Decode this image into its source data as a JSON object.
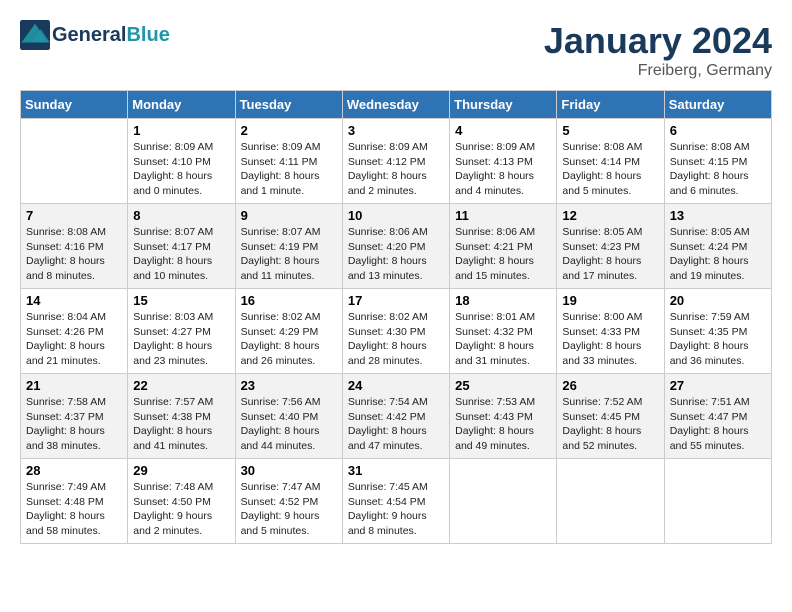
{
  "header": {
    "logo_general": "General",
    "logo_blue": "Blue",
    "month_title": "January 2024",
    "location": "Freiberg, Germany"
  },
  "days_of_week": [
    "Sunday",
    "Monday",
    "Tuesday",
    "Wednesday",
    "Thursday",
    "Friday",
    "Saturday"
  ],
  "weeks": [
    [
      {
        "day": "",
        "sunrise": "",
        "sunset": "",
        "daylight": ""
      },
      {
        "day": "1",
        "sunrise": "Sunrise: 8:09 AM",
        "sunset": "Sunset: 4:10 PM",
        "daylight": "Daylight: 8 hours and 0 minutes."
      },
      {
        "day": "2",
        "sunrise": "Sunrise: 8:09 AM",
        "sunset": "Sunset: 4:11 PM",
        "daylight": "Daylight: 8 hours and 1 minute."
      },
      {
        "day": "3",
        "sunrise": "Sunrise: 8:09 AM",
        "sunset": "Sunset: 4:12 PM",
        "daylight": "Daylight: 8 hours and 2 minutes."
      },
      {
        "day": "4",
        "sunrise": "Sunrise: 8:09 AM",
        "sunset": "Sunset: 4:13 PM",
        "daylight": "Daylight: 8 hours and 4 minutes."
      },
      {
        "day": "5",
        "sunrise": "Sunrise: 8:08 AM",
        "sunset": "Sunset: 4:14 PM",
        "daylight": "Daylight: 8 hours and 5 minutes."
      },
      {
        "day": "6",
        "sunrise": "Sunrise: 8:08 AM",
        "sunset": "Sunset: 4:15 PM",
        "daylight": "Daylight: 8 hours and 6 minutes."
      }
    ],
    [
      {
        "day": "7",
        "sunrise": "Sunrise: 8:08 AM",
        "sunset": "Sunset: 4:16 PM",
        "daylight": "Daylight: 8 hours and 8 minutes."
      },
      {
        "day": "8",
        "sunrise": "Sunrise: 8:07 AM",
        "sunset": "Sunset: 4:17 PM",
        "daylight": "Daylight: 8 hours and 10 minutes."
      },
      {
        "day": "9",
        "sunrise": "Sunrise: 8:07 AM",
        "sunset": "Sunset: 4:19 PM",
        "daylight": "Daylight: 8 hours and 11 minutes."
      },
      {
        "day": "10",
        "sunrise": "Sunrise: 8:06 AM",
        "sunset": "Sunset: 4:20 PM",
        "daylight": "Daylight: 8 hours and 13 minutes."
      },
      {
        "day": "11",
        "sunrise": "Sunrise: 8:06 AM",
        "sunset": "Sunset: 4:21 PM",
        "daylight": "Daylight: 8 hours and 15 minutes."
      },
      {
        "day": "12",
        "sunrise": "Sunrise: 8:05 AM",
        "sunset": "Sunset: 4:23 PM",
        "daylight": "Daylight: 8 hours and 17 minutes."
      },
      {
        "day": "13",
        "sunrise": "Sunrise: 8:05 AM",
        "sunset": "Sunset: 4:24 PM",
        "daylight": "Daylight: 8 hours and 19 minutes."
      }
    ],
    [
      {
        "day": "14",
        "sunrise": "Sunrise: 8:04 AM",
        "sunset": "Sunset: 4:26 PM",
        "daylight": "Daylight: 8 hours and 21 minutes."
      },
      {
        "day": "15",
        "sunrise": "Sunrise: 8:03 AM",
        "sunset": "Sunset: 4:27 PM",
        "daylight": "Daylight: 8 hours and 23 minutes."
      },
      {
        "day": "16",
        "sunrise": "Sunrise: 8:02 AM",
        "sunset": "Sunset: 4:29 PM",
        "daylight": "Daylight: 8 hours and 26 minutes."
      },
      {
        "day": "17",
        "sunrise": "Sunrise: 8:02 AM",
        "sunset": "Sunset: 4:30 PM",
        "daylight": "Daylight: 8 hours and 28 minutes."
      },
      {
        "day": "18",
        "sunrise": "Sunrise: 8:01 AM",
        "sunset": "Sunset: 4:32 PM",
        "daylight": "Daylight: 8 hours and 31 minutes."
      },
      {
        "day": "19",
        "sunrise": "Sunrise: 8:00 AM",
        "sunset": "Sunset: 4:33 PM",
        "daylight": "Daylight: 8 hours and 33 minutes."
      },
      {
        "day": "20",
        "sunrise": "Sunrise: 7:59 AM",
        "sunset": "Sunset: 4:35 PM",
        "daylight": "Daylight: 8 hours and 36 minutes."
      }
    ],
    [
      {
        "day": "21",
        "sunrise": "Sunrise: 7:58 AM",
        "sunset": "Sunset: 4:37 PM",
        "daylight": "Daylight: 8 hours and 38 minutes."
      },
      {
        "day": "22",
        "sunrise": "Sunrise: 7:57 AM",
        "sunset": "Sunset: 4:38 PM",
        "daylight": "Daylight: 8 hours and 41 minutes."
      },
      {
        "day": "23",
        "sunrise": "Sunrise: 7:56 AM",
        "sunset": "Sunset: 4:40 PM",
        "daylight": "Daylight: 8 hours and 44 minutes."
      },
      {
        "day": "24",
        "sunrise": "Sunrise: 7:54 AM",
        "sunset": "Sunset: 4:42 PM",
        "daylight": "Daylight: 8 hours and 47 minutes."
      },
      {
        "day": "25",
        "sunrise": "Sunrise: 7:53 AM",
        "sunset": "Sunset: 4:43 PM",
        "daylight": "Daylight: 8 hours and 49 minutes."
      },
      {
        "day": "26",
        "sunrise": "Sunrise: 7:52 AM",
        "sunset": "Sunset: 4:45 PM",
        "daylight": "Daylight: 8 hours and 52 minutes."
      },
      {
        "day": "27",
        "sunrise": "Sunrise: 7:51 AM",
        "sunset": "Sunset: 4:47 PM",
        "daylight": "Daylight: 8 hours and 55 minutes."
      }
    ],
    [
      {
        "day": "28",
        "sunrise": "Sunrise: 7:49 AM",
        "sunset": "Sunset: 4:48 PM",
        "daylight": "Daylight: 8 hours and 58 minutes."
      },
      {
        "day": "29",
        "sunrise": "Sunrise: 7:48 AM",
        "sunset": "Sunset: 4:50 PM",
        "daylight": "Daylight: 9 hours and 2 minutes."
      },
      {
        "day": "30",
        "sunrise": "Sunrise: 7:47 AM",
        "sunset": "Sunset: 4:52 PM",
        "daylight": "Daylight: 9 hours and 5 minutes."
      },
      {
        "day": "31",
        "sunrise": "Sunrise: 7:45 AM",
        "sunset": "Sunset: 4:54 PM",
        "daylight": "Daylight: 9 hours and 8 minutes."
      },
      {
        "day": "",
        "sunrise": "",
        "sunset": "",
        "daylight": ""
      },
      {
        "day": "",
        "sunrise": "",
        "sunset": "",
        "daylight": ""
      },
      {
        "day": "",
        "sunrise": "",
        "sunset": "",
        "daylight": ""
      }
    ]
  ]
}
